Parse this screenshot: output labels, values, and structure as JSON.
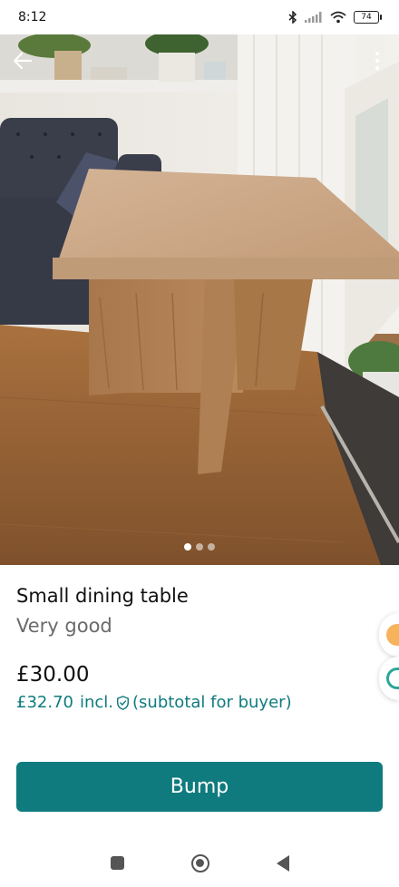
{
  "status_bar": {
    "time": "8:12",
    "battery": "74",
    "icons": [
      "bluetooth-icon",
      "signal-icon",
      "wifi-icon",
      "battery-icon"
    ]
  },
  "photo": {
    "icons": [
      "back-arrow-icon",
      "more-vertical-icon"
    ],
    "carousel_pages": 3,
    "current_page": 1
  },
  "listing": {
    "title": "Small dining table",
    "condition": "Very good",
    "price": "£30.00",
    "buyer_price": "£32.70",
    "buyer_incl": "incl.",
    "buyer_suffix": "(subtotal for buyer)"
  },
  "actions": {
    "bump_label": "Bump"
  },
  "colors": {
    "accent": "#0f7b7e",
    "text_primary": "#111111",
    "text_secondary": "#6a6a6a",
    "side_chip_orange": "#f6b35c",
    "side_chip_teal": "#2aa69a"
  }
}
